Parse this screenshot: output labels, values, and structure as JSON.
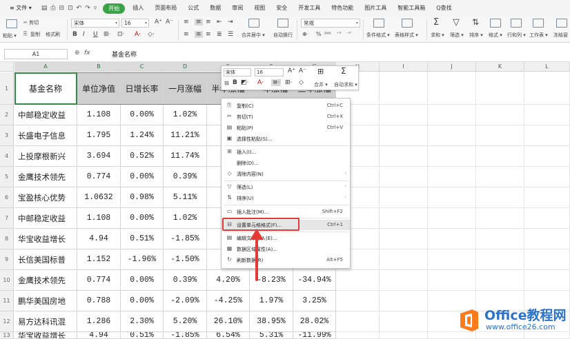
{
  "menubar": {
    "file_label": "≡ 文件 ▾",
    "tabs": [
      "开始",
      "插入",
      "页面布局",
      "公式",
      "数据",
      "审阅",
      "视图",
      "安全",
      "开发工具",
      "特色功能",
      "图片工具",
      "智能工具箱"
    ],
    "active_tab": "开始",
    "search_label": "Q查找"
  },
  "ribbon": {
    "paste_label": "粘贴 ▾",
    "cut_label": "✂ 剪切",
    "copy_label": "复制",
    "format_painter_label": "格式刷",
    "font_name": "宋体",
    "font_size": "16",
    "merge_label": "合并居中 ▾",
    "wrap_label": "自动换行",
    "number_format": "常规",
    "cond_format_label": "条件格式 ▾",
    "table_style_label": "表格样式 ▾",
    "sum_label": "求和 ▾",
    "filter_label": "筛选 ▾",
    "sort_label": "排序 ▾",
    "format_label": "格式 ▾",
    "rowcol_label": "行和列 ▾",
    "sheet_label": "工作表 ▾",
    "freeze_label": "冻结窗"
  },
  "formula_bar": {
    "cell_ref": "A1",
    "fx": "fx",
    "value": "基金名称"
  },
  "columns": [
    "A",
    "B",
    "C",
    "D",
    "E",
    "F",
    "G",
    "H",
    "I",
    "J",
    "K",
    "L"
  ],
  "rows": [
    "1",
    "2",
    "3",
    "4",
    "5",
    "6",
    "7",
    "8",
    "9",
    "10",
    "11",
    "12",
    "13"
  ],
  "headers": [
    "基金名称",
    "单位净值",
    "日增长率",
    "一月涨幅",
    "半年涨幅",
    "一年涨幅",
    "三年涨幅"
  ],
  "table": [
    [
      "中邮稳定收益",
      "1.108",
      "0.00%",
      "1.02%",
      "2",
      "",
      ""
    ],
    [
      "长盛电子信息",
      "1.795",
      "1.24%",
      "11.21%",
      "42",
      "",
      ""
    ],
    [
      "上投摩根新兴",
      "3.694",
      "0.52%",
      "11.74%",
      "40",
      "",
      ""
    ],
    [
      "金鹰技术领先",
      "0.774",
      "0.00%",
      "0.39%",
      "4",
      "",
      ""
    ],
    [
      "宝盈核心优势",
      "1.0632",
      "0.98%",
      "5.11%",
      "49",
      "",
      ""
    ],
    [
      "中邮稳定收益",
      "1.108",
      "0.00%",
      "1.02%",
      "2",
      "",
      ""
    ],
    [
      "华宝收益增长",
      "4.94",
      "0.51%",
      "-1.85%",
      "6",
      "",
      ""
    ],
    [
      "长信美国标普",
      "1.152",
      "-1.96%",
      "-1.50%",
      "-0",
      "",
      ""
    ],
    [
      "金鹰技术领先",
      "0.774",
      "0.00%",
      "0.39%",
      "4.20%",
      "-8.23%",
      "-34.94%"
    ],
    [
      "鹏华美国房地",
      "0.788",
      "0.00%",
      "-2.09%",
      "-4.25%",
      "1.97%",
      "3.25%"
    ],
    [
      "易方达科讯混",
      "1.286",
      "2.30%",
      "5.20%",
      "26.10%",
      "38.95%",
      "28.02%"
    ],
    [
      "华宝收益增长",
      "4.94",
      "0.51%",
      "-1.85%",
      "6.54%",
      "5.31%",
      "-11.99%"
    ]
  ],
  "mini_toolbar": {
    "font_name": "宋体",
    "font_size": "16",
    "merge_label": "合并 ▾",
    "autosum_label": "自动求和 ▾"
  },
  "context_menu": [
    {
      "icon": "copy-icon",
      "label": "复制(C)",
      "shortcut": "Ctrl+C"
    },
    {
      "icon": "cut-icon",
      "label": "剪切(T)",
      "shortcut": "Ctrl+X"
    },
    {
      "icon": "paste-icon",
      "label": "粘贴(P)",
      "shortcut": "Ctrl+V"
    },
    {
      "icon": "paste-special-icon",
      "label": "选择性粘贴(S)...",
      "shortcut": ""
    },
    {
      "icon": "insert-icon",
      "label": "插入(I)...",
      "shortcut": ""
    },
    {
      "icon": "",
      "label": "删除(D)...",
      "shortcut": ""
    },
    {
      "icon": "clear-icon",
      "label": "清除内容(N)",
      "shortcut": ""
    },
    {
      "icon": "filter-icon",
      "label": "筛选(L)",
      "shortcut": ""
    },
    {
      "icon": "sort-icon",
      "label": "排序(U)",
      "shortcut": ""
    },
    {
      "icon": "comment-icon",
      "label": "插入批注(M)...",
      "shortcut": "Shift+F2"
    },
    {
      "icon": "format-cells-icon",
      "label": "设置单元格格式(F)...",
      "shortcut": "Ctrl+1"
    },
    {
      "icon": "text-import-icon",
      "label": "编辑文本导入(E)...",
      "shortcut": ""
    },
    {
      "icon": "data-range-icon",
      "label": "数据区域属性(A)...",
      "shortcut": ""
    },
    {
      "icon": "refresh-icon",
      "label": "刷新数据(R)",
      "shortcut": "Alt+F5"
    }
  ],
  "logo": {
    "brand": "Office教程网",
    "url": "www.office26.com"
  },
  "colors": {
    "accent_green": "#3aa346",
    "selection_green": "#2f8a45",
    "highlight_red": "#e53935",
    "logo_orange": "#ff7a1a",
    "logo_blue": "#2a73c9"
  }
}
